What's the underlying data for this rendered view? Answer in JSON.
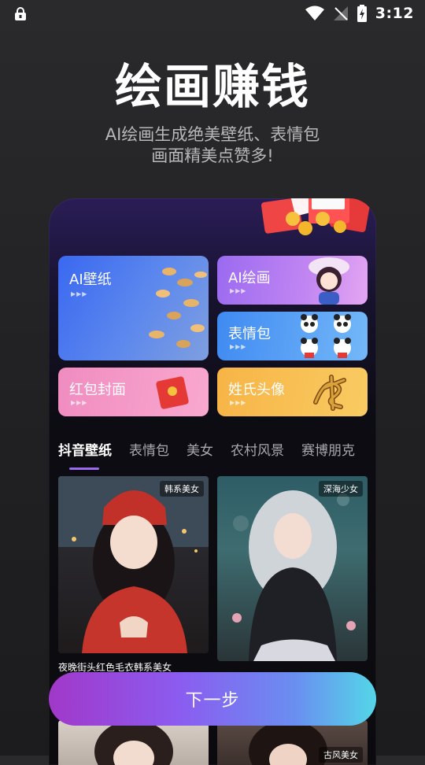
{
  "status_bar": {
    "time": "3:12"
  },
  "header": {
    "title": "绘画赚钱",
    "subtitle_line1": "AI绘画生成绝美壁纸、表情包",
    "subtitle_line2": "画面精美点赞多!"
  },
  "features": [
    {
      "label": "AI壁纸"
    },
    {
      "label": "AI绘画"
    },
    {
      "label": "表情包"
    },
    {
      "label": "红包封面"
    },
    {
      "label": "姓氏头像"
    }
  ],
  "tabs": [
    "抖音壁纸",
    "表情包",
    "美女",
    "农村风景",
    "赛博朋克"
  ],
  "active_tab": 0,
  "gallery": [
    {
      "tag": "韩系美女",
      "caption": "夜晚街头红色毛衣韩系美女"
    },
    {
      "tag": "深海少女"
    },
    {
      "tag": ""
    },
    {
      "tag": "古风美女"
    }
  ],
  "next_button": "下一步",
  "colors": {
    "accent": "#9a6af0",
    "button_start": "#a138c9",
    "button_end": "#54d6e8"
  }
}
